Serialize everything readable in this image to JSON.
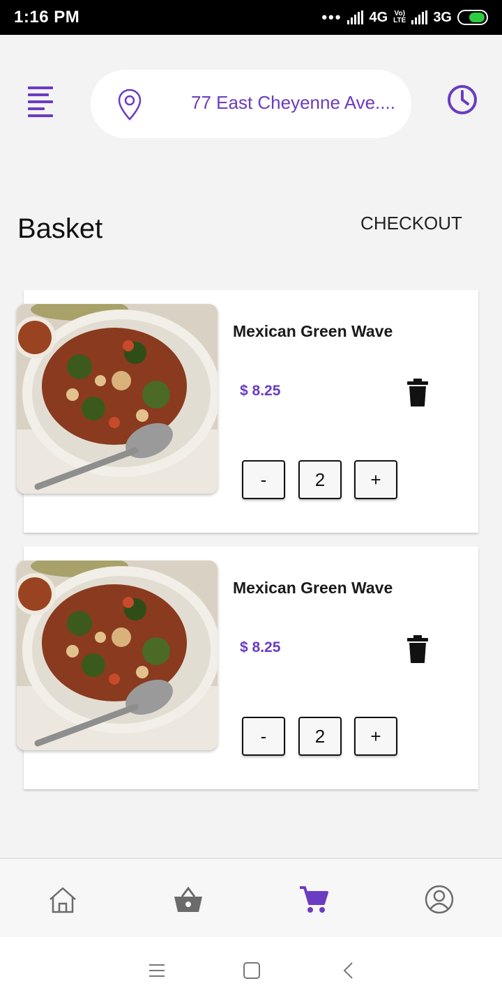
{
  "status_bar": {
    "time": "1:16 PM",
    "net1": "4G",
    "volte_top": "Vo)",
    "volte_bottom": "LTE",
    "net2": "3G"
  },
  "header": {
    "address": "77 East Cheyenne Ave....",
    "menu_icon": "menu-icon",
    "location_icon": "location-pin-icon",
    "history_icon": "clock-icon"
  },
  "page": {
    "title": "Basket",
    "checkout_label": "CHECKOUT"
  },
  "basket": {
    "items": [
      {
        "name": "Mexican Green Wave",
        "price": "$ 8.25",
        "quantity": "2",
        "minus": "-",
        "plus": "+"
      },
      {
        "name": "Mexican Green Wave",
        "price": "$ 8.25",
        "quantity": "2",
        "minus": "-",
        "plus": "+"
      }
    ]
  },
  "bottom_nav": {
    "items": [
      "home-icon",
      "basket-icon",
      "cart-icon",
      "profile-icon"
    ],
    "active": "cart-icon"
  },
  "colors": {
    "accent": "#6a3cc1",
    "text": "#1a1a1a",
    "inactive_icon": "#6b6b6b"
  }
}
